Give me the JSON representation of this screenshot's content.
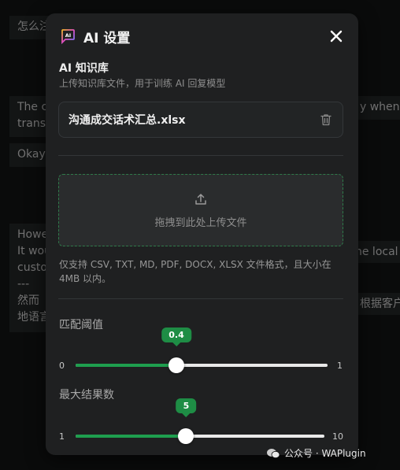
{
  "background_chat": {
    "msg1": "怎么注",
    "msg2_left": "The c\ntrans",
    "msg2_right": "y when",
    "msg3": "Okay,",
    "msg4_left": "Howe\nIt wou\ncusto\n---\n然而\n地语言",
    "msg4_right_a": "he local",
    "msg4_right_b": "根据客户"
  },
  "modal": {
    "title": "AI 设置",
    "section_title": "AI 知识库",
    "section_desc": "上传知识库文件，用于训练 AI 回复模型",
    "file_name": "沟通成交话术汇总.xlsx",
    "dropzone_label": "拖拽到此处上传文件",
    "hint": "仅支持 CSV, TXT, MD, PDF, DOCX, XLSX 文件格式，且大小在 4MB 以内。",
    "sliders": [
      {
        "label": "匹配阈值",
        "min": "0",
        "max": "1",
        "value": "0.4",
        "min_num": 0,
        "max_num": 1,
        "value_num": 0.4
      },
      {
        "label": "最大结果数",
        "min": "1",
        "max": "10",
        "value": "5",
        "min_num": 1,
        "max_num": 10,
        "value_num": 5
      }
    ]
  },
  "watermark": "公众号 · WAPlugin",
  "colors": {
    "accent": "#1e9e4e",
    "dashed_border": "#2f7b4a",
    "modal_bg": "#1f2021"
  }
}
